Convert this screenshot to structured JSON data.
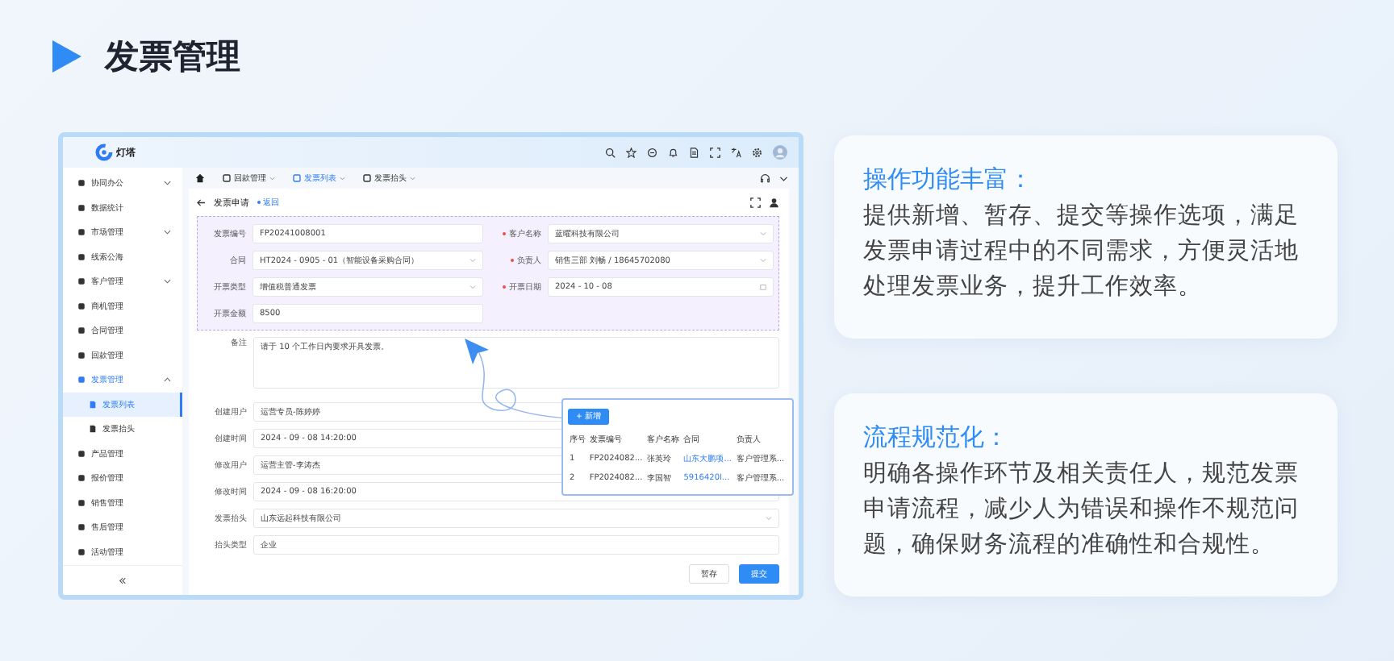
{
  "header": {
    "title": "发票管理"
  },
  "app": {
    "logo": "灯塔",
    "sidebar": {
      "items": [
        {
          "label": "协同办公",
          "selected": false,
          "expanded": false
        },
        {
          "label": "数据统计",
          "selected": false
        },
        {
          "label": "市场管理",
          "selected": false,
          "expanded": false
        },
        {
          "label": "线索公海",
          "selected": false
        },
        {
          "label": "客户管理",
          "selected": false,
          "expanded": false
        },
        {
          "label": "商机管理",
          "selected": false
        },
        {
          "label": "合同管理",
          "selected": false
        },
        {
          "label": "回款管理",
          "selected": false
        },
        {
          "label": "发票管理",
          "selected": false,
          "expanded": true,
          "children": [
            {
              "label": "发票列表",
              "selected": true
            },
            {
              "label": "发票抬头",
              "selected": false
            }
          ]
        },
        {
          "label": "产品管理",
          "selected": false
        },
        {
          "label": "报价管理",
          "selected": false
        },
        {
          "label": "销售管理",
          "selected": false
        },
        {
          "label": "售后管理",
          "selected": false
        },
        {
          "label": "活动管理",
          "selected": false
        }
      ]
    },
    "tabs": [
      {
        "label": "回款管理",
        "selected": false
      },
      {
        "label": "发票列表",
        "selected": true
      },
      {
        "label": "发票抬头",
        "selected": false
      }
    ],
    "page": {
      "title": "发票申请",
      "back_link": "返回"
    },
    "form": {
      "left": [
        {
          "label": "发票编号",
          "value": "FP20241008001",
          "kind": "text"
        },
        {
          "label": "合同",
          "value": "HT2024 - 0905 - 01（智能设备采购合同）",
          "kind": "select"
        },
        {
          "label": "开票类型",
          "value": "增值税普通发票",
          "kind": "select"
        },
        {
          "label": "开票金额",
          "value": "8500",
          "kind": "text"
        }
      ],
      "right": [
        {
          "label": "客户名称",
          "value": "蓝曜科技有限公司",
          "kind": "select",
          "required": true
        },
        {
          "label": "负责人",
          "value": "销售三部 刘畅 / 18645702080",
          "kind": "select",
          "required": true
        },
        {
          "label": "开票日期",
          "value": "2024 - 10 - 08",
          "kind": "date",
          "required": true
        }
      ],
      "remark": {
        "label": "备注",
        "value": "请于 10 个工作日内要求开具发票。"
      },
      "lower": [
        {
          "label": "创建用户",
          "value": "运营专员-陈婷婷",
          "kind": "text"
        },
        {
          "label": "创建时间",
          "value": "2024 - 09 - 08 14:20:00",
          "kind": "text"
        },
        {
          "label": "修改用户",
          "value": "运营主管-李涛杰",
          "kind": "text"
        },
        {
          "label": "修改时间",
          "value": "2024 - 09 - 08 16:20:00",
          "kind": "text"
        },
        {
          "label": "发票抬头",
          "value": "山东远起科技有限公司",
          "kind": "select"
        },
        {
          "label": "抬头类型",
          "value": "企业",
          "kind": "text"
        }
      ]
    },
    "popup": {
      "add_button": "+ 新增",
      "columns": [
        "序号",
        "发票编号",
        "客户名称",
        "合同",
        "负责人"
      ],
      "rows": [
        [
          "1",
          "FP2024082...",
          "张英玲",
          "山东大鹏项...",
          "客户管理系..."
        ],
        [
          "2",
          "FP2024082...",
          "李国智",
          "5916420l...",
          "客户管理系..."
        ]
      ]
    },
    "buttons": [
      {
        "label": "暂存",
        "kind": "default"
      },
      {
        "label": "提交",
        "kind": "primary"
      }
    ]
  },
  "cards": [
    {
      "title": "操作功能丰富：",
      "body": "提供新增、暂存、提交等操作选项，满足发票申请过程中的不同需求，方便灵活地处理发票业务，提升工作效率。"
    },
    {
      "title": "流程规范化：",
      "body": "明确各操作环节及相关责任人，规范发票申请流程，减少人为错误和操作不规范问题，确保财务流程的准确性和合规性。"
    }
  ]
}
